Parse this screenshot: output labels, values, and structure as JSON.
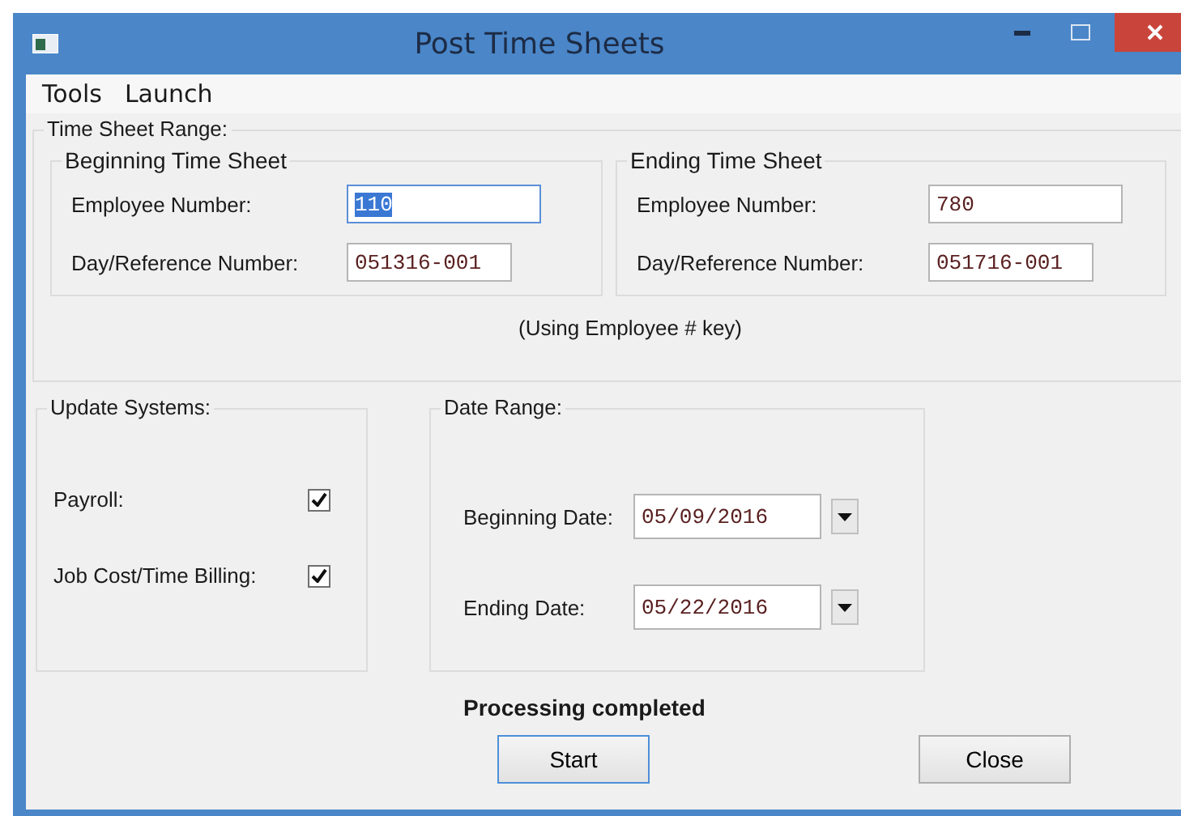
{
  "window": {
    "title": "Post Time Sheets"
  },
  "menu": [
    "Tools",
    "Launch"
  ],
  "time_sheet_range": {
    "title": "Time Sheet Range:",
    "groups": [
      {
        "title": "Beginning Time Sheet",
        "fields": [
          {
            "label": "Employee Number:",
            "value": "110",
            "focused": true
          },
          {
            "label": "Day/Reference Number:",
            "value": "051316-001",
            "focused": false
          }
        ]
      },
      {
        "title": "Ending Time Sheet",
        "fields": [
          {
            "label": "Employee Number:",
            "value": "780",
            "focused": false
          },
          {
            "label": "Day/Reference Number:",
            "value": "051716-001",
            "focused": false
          }
        ]
      }
    ],
    "note": "(Using Employee # key)"
  },
  "update_systems": {
    "title": "Update Systems:",
    "items": [
      {
        "label": "Payroll:",
        "checked": true
      },
      {
        "label": "Job Cost/Time Billing:",
        "checked": true
      }
    ]
  },
  "date_range": {
    "title": "Date Range:",
    "fields": [
      {
        "label": "Beginning Date:",
        "value": "05/09/2016"
      },
      {
        "label": "Ending Date:",
        "value": "05/22/2016"
      }
    ]
  },
  "status": "Processing completed",
  "buttons": [
    {
      "label": "Start",
      "focused": true
    },
    {
      "label": "Close",
      "focused": false
    }
  ]
}
